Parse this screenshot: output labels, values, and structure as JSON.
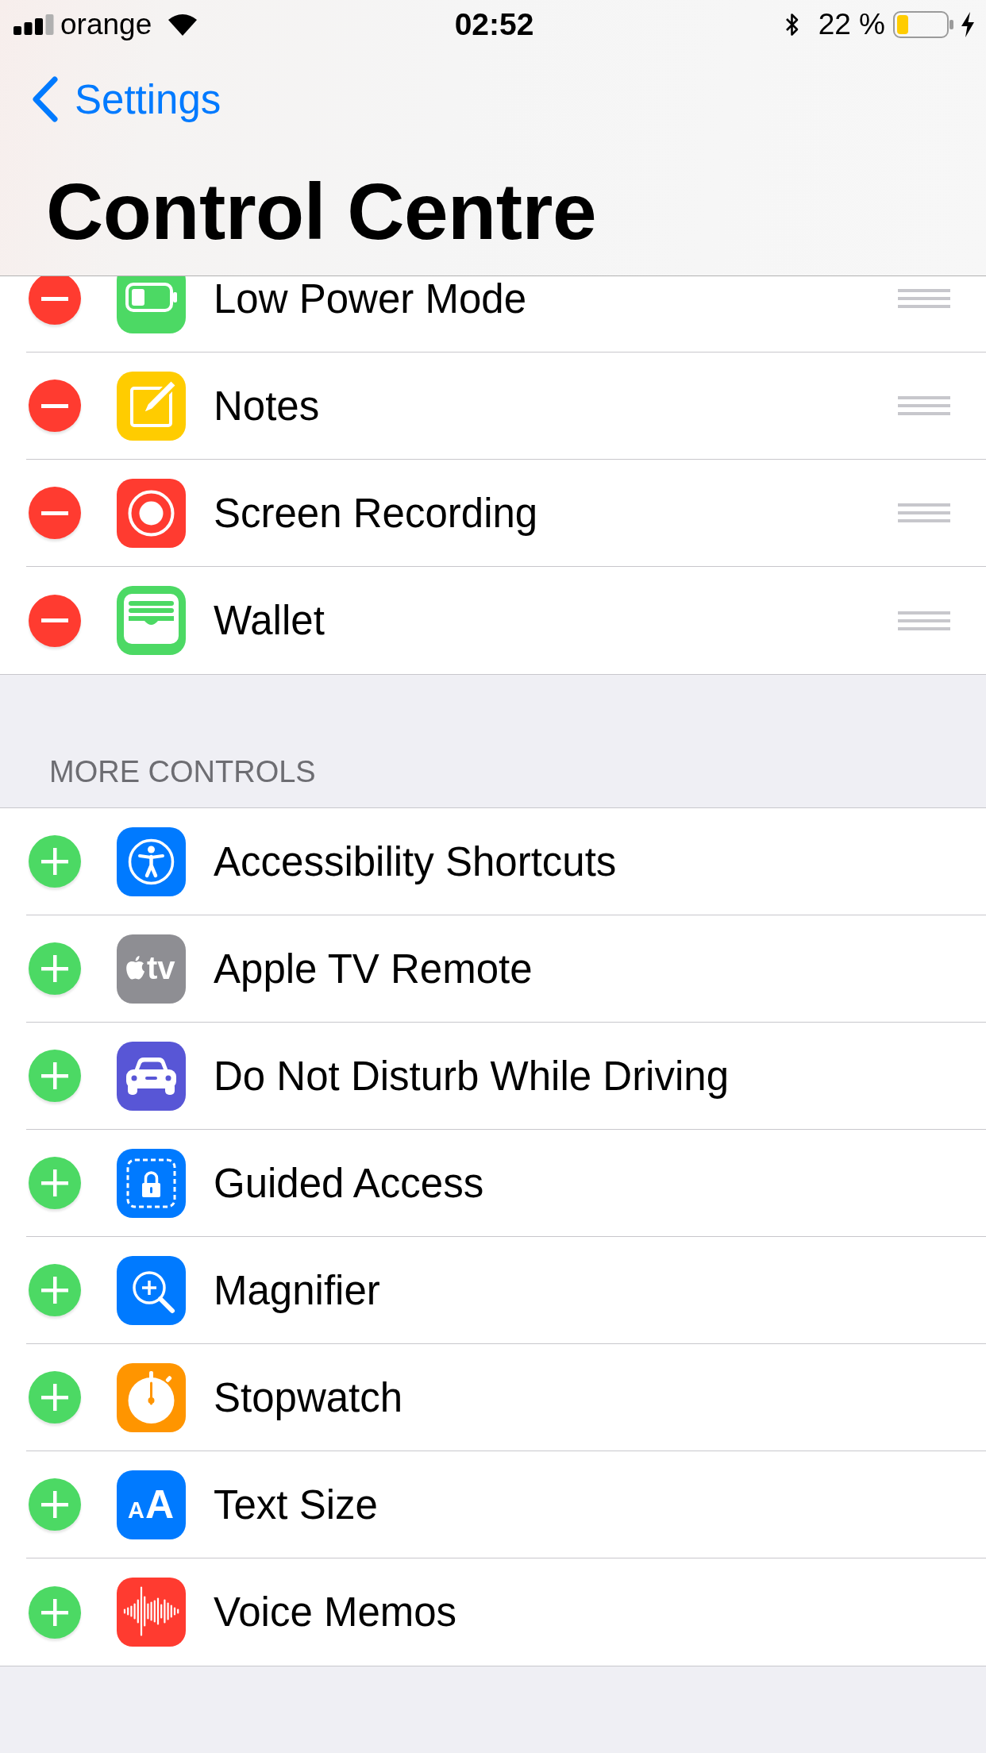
{
  "status_bar": {
    "carrier": "orange",
    "time": "02:52",
    "battery_percent": "22 %"
  },
  "navigation": {
    "back_label": "Settings",
    "title": "Control Centre"
  },
  "included_controls": [
    {
      "label": "Low Power Mode"
    },
    {
      "label": "Notes"
    },
    {
      "label": "Screen Recording"
    },
    {
      "label": "Wallet"
    }
  ],
  "more_controls": {
    "header": "MORE CONTROLS",
    "items": [
      {
        "label": "Accessibility Shortcuts"
      },
      {
        "label": "Apple TV Remote",
        "icon_text": [
          "tv"
        ]
      },
      {
        "label": "Do Not Disturb While Driving"
      },
      {
        "label": "Guided Access"
      },
      {
        "label": "Magnifier"
      },
      {
        "label": "Stopwatch"
      },
      {
        "label": "Text Size",
        "icon_text": [
          "A",
          "A"
        ]
      },
      {
        "label": "Voice Memos"
      }
    ]
  }
}
